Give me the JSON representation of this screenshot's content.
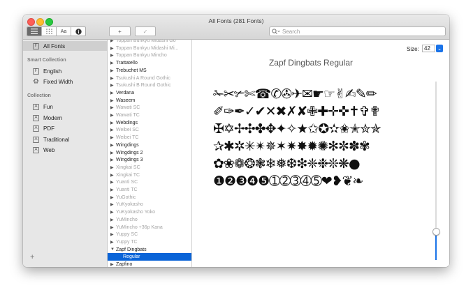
{
  "window": {
    "title": "All Fonts (281 Fonts)"
  },
  "toolbar": {
    "view_buttons": [
      {
        "name": "sidebar-toggle-icon",
        "glyph": "☰"
      },
      {
        "name": "grid-view-icon",
        "glyph": "⠿"
      },
      {
        "name": "sample-view-label",
        "glyph": "Aa"
      },
      {
        "name": "info-icon",
        "glyph": "i"
      }
    ],
    "add_label": "+",
    "check_label": "✓",
    "search_placeholder": "Search"
  },
  "sidebar": {
    "library_items": [
      {
        "label": "All Fonts",
        "icon": "F",
        "selected": true
      }
    ],
    "smart_heading": "Smart Collection",
    "smart_items": [
      {
        "label": "English",
        "icon": "F"
      },
      {
        "label": "Fixed Width",
        "icon": "gear-icon"
      }
    ],
    "collection_heading": "Collection",
    "collection_items": [
      {
        "label": "Fun",
        "icon": "A"
      },
      {
        "label": "Modern",
        "icon": "A"
      },
      {
        "label": "PDF",
        "icon": "A"
      },
      {
        "label": "Traditional",
        "icon": "A"
      },
      {
        "label": "Web",
        "icon": "A"
      }
    ],
    "add_label": "+"
  },
  "font_list": [
    {
      "label": "Toppan Bunkyu Midashi Go",
      "gray": true,
      "tri": "▶"
    },
    {
      "label": "Toppan Bunkyu Midashi Mi...",
      "gray": true,
      "tri": "▶"
    },
    {
      "label": "Toppan Bunkyu Mincho",
      "gray": true,
      "tri": "▶"
    },
    {
      "label": "Trattatello",
      "gray": false,
      "tri": "▶"
    },
    {
      "label": "Trebuchet MS",
      "gray": false,
      "tri": "▶"
    },
    {
      "label": "Tsukushi A Round Gothic",
      "gray": true,
      "tri": "▶"
    },
    {
      "label": "Tsukushi B Round Gothic",
      "gray": true,
      "tri": "▶"
    },
    {
      "label": "Verdana",
      "gray": false,
      "tri": "▶"
    },
    {
      "label": "Waseem",
      "gray": false,
      "tri": "▶"
    },
    {
      "label": "Wawati SC",
      "gray": true,
      "tri": "▶"
    },
    {
      "label": "Wawati TC",
      "gray": true,
      "tri": "▶"
    },
    {
      "label": "Webdings",
      "gray": false,
      "tri": "▶"
    },
    {
      "label": "Weibei SC",
      "gray": true,
      "tri": "▶"
    },
    {
      "label": "Weibei TC",
      "gray": true,
      "tri": "▶"
    },
    {
      "label": "Wingdings",
      "gray": false,
      "tri": "▶"
    },
    {
      "label": "Wingdings 2",
      "gray": false,
      "tri": "▶"
    },
    {
      "label": "Wingdings 3",
      "gray": false,
      "tri": "▶"
    },
    {
      "label": "Xingkai SC",
      "gray": true,
      "tri": "▶"
    },
    {
      "label": "Xingkai TC",
      "gray": true,
      "tri": "▶"
    },
    {
      "label": "Yuanti SC",
      "gray": true,
      "tri": "▶"
    },
    {
      "label": "Yuanti TC",
      "gray": true,
      "tri": "▶"
    },
    {
      "label": "YuGothic",
      "gray": true,
      "tri": "▶"
    },
    {
      "label": "YuKyokasho",
      "gray": true,
      "tri": "▶"
    },
    {
      "label": "YuKyokasho Yoko",
      "gray": true,
      "tri": "▶"
    },
    {
      "label": "YuMincho",
      "gray": true,
      "tri": "▶"
    },
    {
      "label": "YuMincho +36p Kana",
      "gray": true,
      "tri": "▶"
    },
    {
      "label": "Yuppy SC",
      "gray": true,
      "tri": "▶"
    },
    {
      "label": "Yuppy TC",
      "gray": true,
      "tri": "▶"
    },
    {
      "label": "Zapf Dingbats",
      "gray": false,
      "tri": "▼"
    },
    {
      "label": "Regular",
      "gray": false,
      "tri": "",
      "selected": true,
      "indent": true
    },
    {
      "label": "Zapfino",
      "gray": false,
      "tri": "▶"
    }
  ],
  "preview": {
    "size_label": "Size:",
    "size_value": "42",
    "font_title": "Zapf Dingbats Regular",
    "glyph_rows": [
      "✁✂✃✄☎✆✇✈✉☛☞✌✍✎✏",
      "✐✑✒✓✔✕✖✗✘✙✚✛✜✝✞✟",
      "✠✡✢✣✤✥✦✧★✩✪✫✬✭✮✯",
      "✰✱✲✳✴✵✶✷✸✹✺✻✼✽✾",
      "✿❀❁❂❃❄❅❆❇❈❉❊❋●",
      "❶❷❸❹❺➀➁➂➃➄❤❥❦❧"
    ],
    "slider_level": 0.16
  },
  "colors": {
    "accent": "#1a73e8",
    "selection": "#0a64d8"
  }
}
